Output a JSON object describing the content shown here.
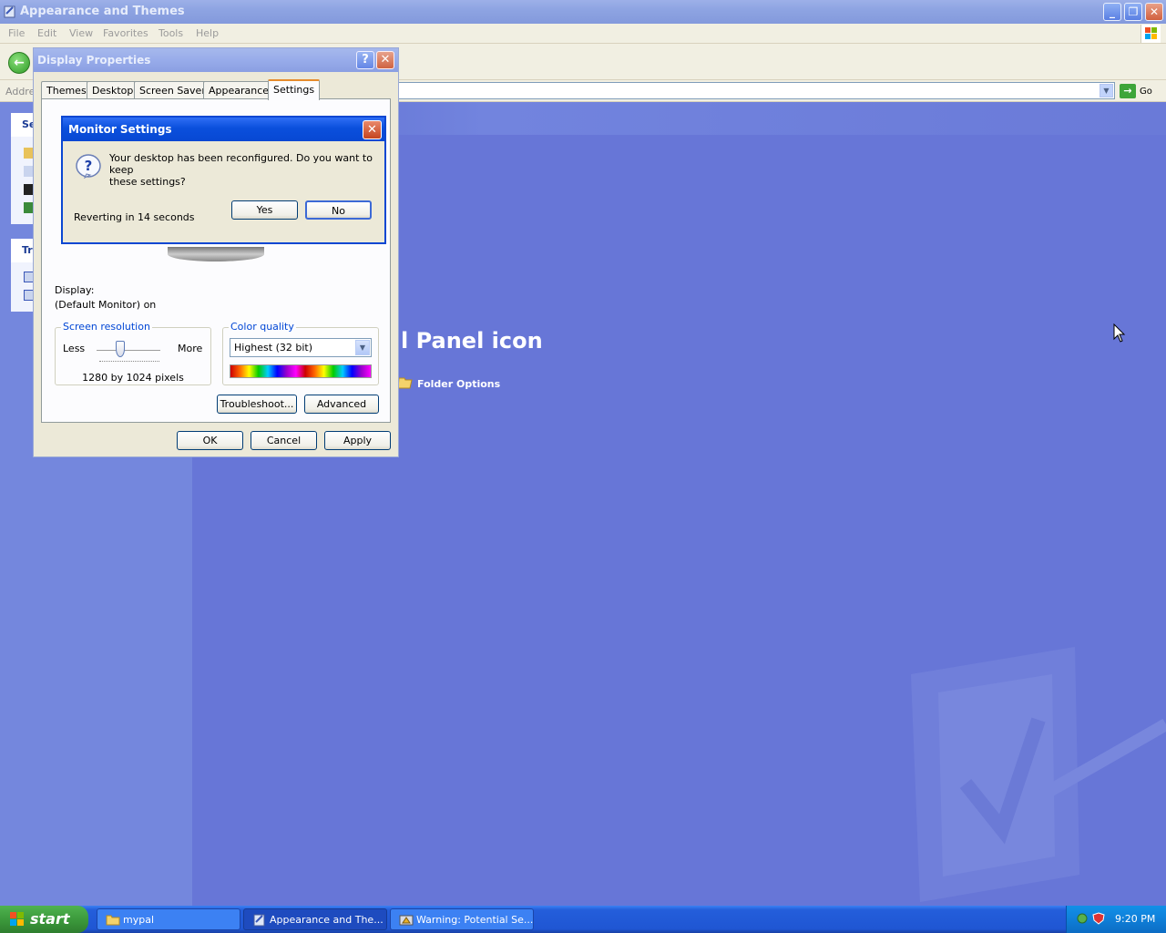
{
  "explorer": {
    "title": "Appearance and Themes",
    "menu": [
      "File",
      "Edit",
      "View",
      "Favorites",
      "Tools",
      "Help"
    ],
    "address_label": "Addre",
    "go_label": "Go",
    "left_pane": {
      "panel1_head": "Se",
      "panel2_head": "Tr"
    },
    "main_heading": "l Panel icon",
    "folder_options_label": "Folder Options"
  },
  "display_properties": {
    "title": "Display Properties",
    "help_glyph": "?",
    "close_glyph": "✕",
    "tabs": [
      "Themes",
      "Desktop",
      "Screen Saver",
      "Appearance",
      "Settings"
    ],
    "active_tab": "Settings",
    "display_label": "Display:",
    "display_value": "(Default Monitor) on",
    "screen_resolution": {
      "legend": "Screen resolution",
      "less": "Less",
      "more": "More",
      "value": "1280 by 1024 pixels"
    },
    "color_quality": {
      "legend": "Color quality",
      "selected": "Highest (32 bit)"
    },
    "buttons": {
      "troubleshoot": "Troubleshoot...",
      "advanced": "Advanced",
      "ok": "OK",
      "cancel": "Cancel",
      "apply": "Apply"
    }
  },
  "monitor_settings": {
    "title": "Monitor Settings",
    "message_line1": "Your desktop has been reconfigured.  Do you want to keep",
    "message_line2": "these settings?",
    "revert_text": "Reverting in 14 seconds",
    "yes": "Yes",
    "no": "No"
  },
  "taskbar": {
    "start_label": "start",
    "items": [
      {
        "label": "mypal",
        "icon": "folder-icon"
      },
      {
        "label": "Appearance and The...",
        "icon": "control-panel-icon",
        "active": true
      },
      {
        "label": "Warning: Potential Se...",
        "icon": "warning-window-icon"
      }
    ],
    "clock": "9:20 PM"
  },
  "colors": {
    "xp_blue": "#0a47d2",
    "taskbar": "#245edb",
    "start_green": "#3c9a3c",
    "desktop_blue": "#6776d7"
  }
}
